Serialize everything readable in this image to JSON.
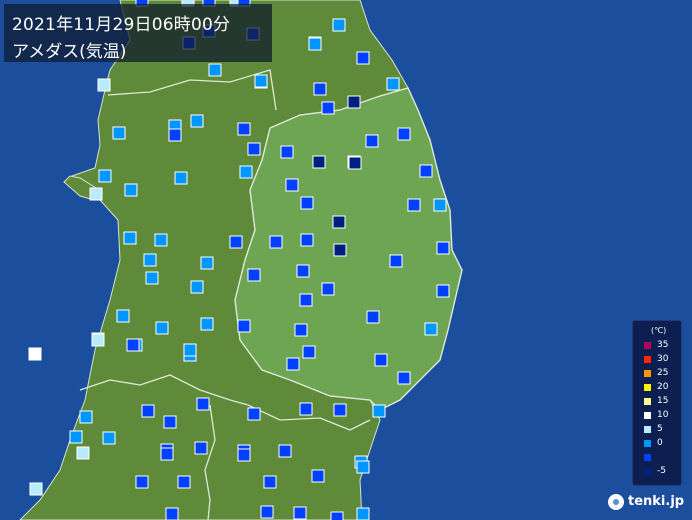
{
  "title": {
    "datetime": "2021年11月29日06時00分",
    "subtitle": "アメダス(気温)"
  },
  "colors": {
    "sea": "#1b4f9e",
    "land_west": "#5e8a3a",
    "land_iwate": "#6ea552",
    "boundary": "#dfe8d8"
  },
  "legend": {
    "unit": "(℃)",
    "items": [
      {
        "label": "35",
        "color": "#b4005a"
      },
      {
        "label": "30",
        "color": "#ff2800"
      },
      {
        "label": "25",
        "color": "#ff9900"
      },
      {
        "label": "20",
        "color": "#faf500"
      },
      {
        "label": "15",
        "color": "#fffa96"
      },
      {
        "label": "10",
        "color": "#ffffff"
      },
      {
        "label": "5",
        "color": "#b9ebff"
      },
      {
        "label": "0",
        "color": "#0096ff"
      },
      {
        "label": "",
        "color": "#0041ff"
      },
      {
        "label": "-5",
        "color": "#002080"
      }
    ]
  },
  "brand": {
    "text": "tenki.jp",
    "icon": "tenki-logo-icon"
  },
  "stations": [
    {
      "c": "#b9ebff"
    },
    {
      "c": "#b9ebff"
    },
    {
      "c": "#b9ebff"
    },
    {
      "c": "#b9ebff"
    },
    {
      "c": "#0096ff"
    },
    {
      "c": "#0041ff"
    },
    {
      "c": "#0041ff"
    },
    {
      "c": "#0041ff"
    },
    {
      "c": "#002080"
    },
    {
      "c": "#0096ff"
    },
    {
      "c": "#0041ff"
    },
    {
      "c": "#002080"
    },
    {
      "c": "#0096ff"
    },
    {
      "c": "#0096ff"
    },
    {
      "c": "#0096ff"
    },
    {
      "c": "#0041ff"
    },
    {
      "c": "#0041ff"
    },
    {
      "c": "#0041ff"
    },
    {
      "c": "#0096ff"
    },
    {
      "c": "#0041ff"
    },
    {
      "c": "#0041ff"
    },
    {
      "c": "#002080"
    },
    {
      "c": "#002080"
    },
    {
      "c": "#0041ff"
    },
    {
      "c": "#0096ff"
    },
    {
      "c": "#0096ff"
    },
    {
      "c": "#0096ff"
    },
    {
      "c": "#0096ff"
    },
    {
      "c": "#0096ff"
    },
    {
      "c": "#0041ff"
    },
    {
      "c": "#0041ff"
    },
    {
      "c": "#0041ff"
    },
    {
      "c": "#0096ff"
    },
    {
      "c": "#0096ff"
    },
    {
      "c": "#0041ff"
    },
    {
      "c": "#0041ff"
    },
    {
      "c": "#0041ff"
    },
    {
      "c": "#002080"
    },
    {
      "c": "#002080"
    },
    {
      "c": "#0041ff"
    },
    {
      "c": "#0096ff"
    },
    {
      "c": "#0096ff"
    },
    {
      "c": "#0096ff"
    },
    {
      "c": "#0041ff"
    },
    {
      "c": "#0041ff"
    },
    {
      "c": "#0041ff"
    },
    {
      "c": "#0041ff"
    },
    {
      "c": "#0041ff"
    },
    {
      "c": "#0096ff"
    },
    {
      "c": "#0096ff"
    },
    {
      "c": "#0041ff"
    },
    {
      "c": "#0041ff"
    },
    {
      "c": "#0041ff"
    },
    {
      "c": "#0096ff"
    },
    {
      "c": "#0041ff"
    },
    {
      "c": "#0096ff"
    },
    {
      "c": "#0041ff"
    },
    {
      "c": "#0041ff"
    },
    {
      "c": "#0041ff"
    },
    {
      "c": "#0096ff"
    },
    {
      "c": "#0096ff"
    },
    {
      "c": "#0041ff"
    },
    {
      "c": "#0041ff"
    },
    {
      "c": "#0041ff"
    },
    {
      "c": "#0041ff"
    },
    {
      "c": "#0096ff"
    },
    {
      "c": "#0041ff"
    },
    {
      "c": "#0041ff"
    },
    {
      "c": "#0041ff"
    },
    {
      "c": "#0041ff"
    },
    {
      "c": "#0041ff"
    },
    {
      "c": "#0041ff"
    },
    {
      "c": "#0096ff"
    },
    {
      "c": "#0041ff"
    },
    {
      "c": "#0041ff"
    },
    {
      "c": "#0041ff"
    },
    {
      "c": "#0041ff"
    },
    {
      "c": "#0041ff"
    },
    {
      "c": "#0041ff"
    },
    {
      "c": "#0041ff"
    },
    {
      "c": "#0096ff"
    },
    {
      "c": "#0041ff"
    },
    {
      "c": "#0041ff"
    },
    {
      "c": "#0041ff"
    },
    {
      "c": "#0096ff"
    },
    {
      "c": "#0041ff"
    },
    {
      "c": "#0041ff"
    },
    {
      "c": "#0041ff"
    },
    {
      "c": "#0096ff"
    },
    {
      "c": "#b9ebff"
    },
    {
      "c": "#0096ff"
    },
    {
      "c": "#ffffff"
    },
    {
      "c": "#b9ebff"
    },
    {
      "c": "#b9ebff"
    },
    {
      "c": "#0096ff"
    },
    {
      "c": "#0096ff"
    },
    {
      "c": "#0041ff"
    },
    {
      "c": "#0041ff"
    },
    {
      "c": "#0096ff"
    },
    {
      "c": "#b9ebff"
    },
    {
      "c": "#0096ff"
    },
    {
      "c": "#0041ff"
    },
    {
      "c": "#0041ff"
    },
    {
      "c": "#0096ff"
    },
    {
      "c": "#0041ff"
    },
    {
      "c": "#0096ff"
    },
    {
      "c": "#0096ff"
    },
    {
      "c": "#0096ff"
    }
  ]
}
